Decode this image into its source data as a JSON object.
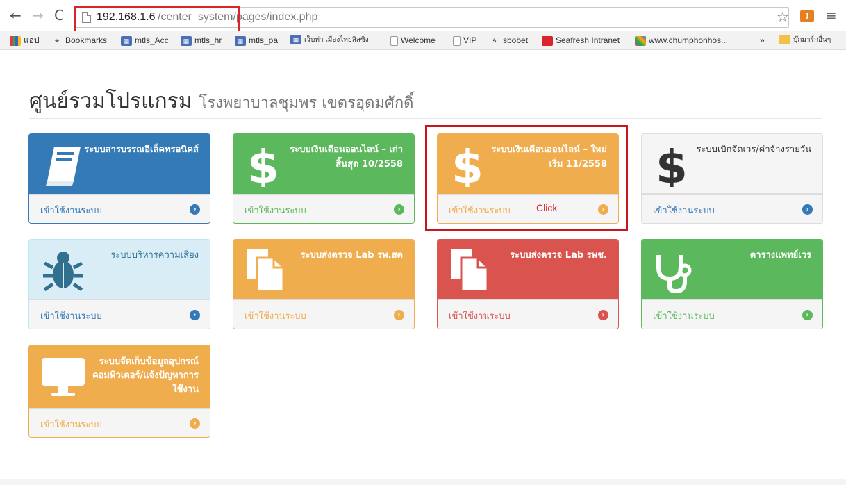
{
  "browser": {
    "url_host": "192.168.1.6",
    "url_path": "/center_system/pages/index.php",
    "bookmarks": [
      {
        "label": "แอป",
        "icon": "apps-icon"
      },
      {
        "label": "Bookmarks",
        "icon": "star-icon"
      },
      {
        "label": "mtls_Acc",
        "icon": "database-icon"
      },
      {
        "label": "mtls_hr",
        "icon": "database-icon"
      },
      {
        "label": "mtls_pa",
        "icon": "database-icon"
      },
      {
        "label": "เว็บท่า เมืองไทยลิสซิ่ง",
        "icon": "database-icon"
      },
      {
        "label": "Welcome",
        "icon": "page-icon"
      },
      {
        "label": "VIP",
        "icon": "page-icon"
      },
      {
        "label": "sbobet",
        "icon": "bolt-icon"
      },
      {
        "label": "Seafresh Intranet",
        "icon": "red-square-icon"
      },
      {
        "label": "www.chumphonhos...",
        "icon": "joomla-icon"
      },
      {
        "label": "»",
        "icon": ""
      },
      {
        "label": "บุ๊กมาร์กอื่นๆ",
        "icon": "folder-icon"
      }
    ]
  },
  "page": {
    "title": "ศูนย์รวมโปรแกรม",
    "subtitle": "โรงพยาบาลชุมพร เขตรอุดมศักดิ์",
    "footer_label": "เข้าใช้งานระบบ",
    "click_label": "Click"
  },
  "panels": [
    {
      "title": "ระบบสารบรรณอิเล็คทรอนิคส์",
      "icon": "book-icon",
      "variant": "blue"
    },
    {
      "title": "ระบบเงินเดือนออนไลน์ – เก่า สิ้นสุด 10/2558",
      "icon": "dollar-icon",
      "variant": "green"
    },
    {
      "title": "ระบบเงินเดือนออนไลน์ – ใหม่ เริ่ม 11/2558",
      "icon": "dollar-icon",
      "variant": "orange"
    },
    {
      "title": "ระบบเบิกจัดเวร/ค่าจ้างรายวัน",
      "icon": "dollar-icon",
      "variant": "default"
    },
    {
      "title": "ระบบบริหารความเสี่ยง",
      "icon": "bug-icon",
      "variant": "info"
    },
    {
      "title": "ระบบส่งตรวจ Lab รพ.สต",
      "icon": "files-icon",
      "variant": "orange"
    },
    {
      "title": "ระบบส่งตรวจ Lab รพช.",
      "icon": "files-icon",
      "variant": "red"
    },
    {
      "title": "ตารางแพทย์เวร",
      "icon": "stethoscope-icon",
      "variant": "green"
    },
    {
      "title": "ระบบจัดเก็บข้อมูลอุปกรณ์คอมพิวเตอร์/แจ้งปัญหาการใช้งาน",
      "icon": "monitor-icon",
      "variant": "orange"
    }
  ],
  "colors": {
    "primary": "#337ab7",
    "success": "#5cb85c",
    "warning": "#f0ad4e",
    "danger": "#d9534f",
    "info_bg": "#d9edf7",
    "highlight": "#d9242b"
  }
}
